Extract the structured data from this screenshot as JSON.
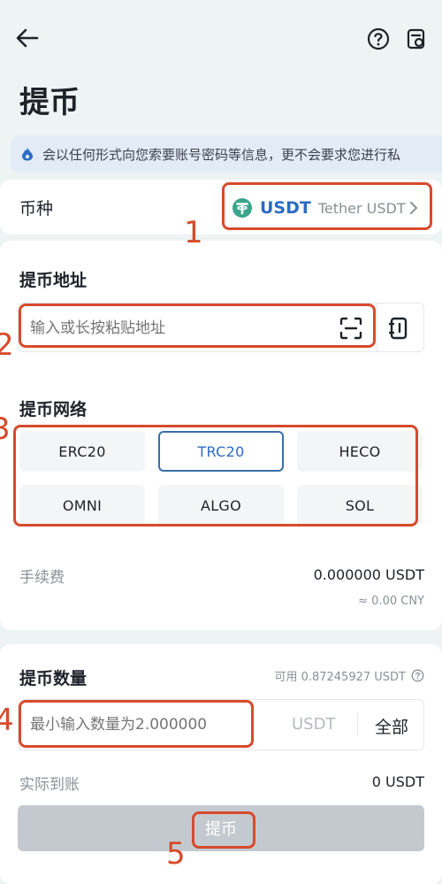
{
  "header": {
    "title": "提币"
  },
  "notice": {
    "text": "会以任何形式向您索要账号密码等信息，更不会要求您进行私"
  },
  "currency": {
    "label": "币种",
    "symbol": "USDT",
    "full_name": "Tether USDT"
  },
  "address": {
    "title": "提币地址",
    "placeholder": "输入或长按粘贴地址"
  },
  "network": {
    "title": "提币网络",
    "options": [
      "ERC20",
      "TRC20",
      "HECO",
      "OMNI",
      "ALGO",
      "SOL"
    ],
    "selected": "TRC20"
  },
  "fee": {
    "label": "手续费",
    "value": "0.000000 USDT",
    "cny": "≈ 0.00 CNY"
  },
  "amount": {
    "title": "提币数量",
    "available": "可用 0.87245927 USDT",
    "placeholder": "最小输入数量为2.000000",
    "unit": "USDT",
    "all_label": "全部"
  },
  "received": {
    "label": "实际到账",
    "value": "0 USDT"
  },
  "submit": {
    "label": "提币"
  },
  "annotations": [
    "1",
    "2",
    "3",
    "4",
    "5"
  ],
  "colors": {
    "background": "#eef3f3",
    "accent": "#2b6cc4",
    "annotation": "#d64b2c",
    "tether": "#3aa58c",
    "submit_button": "#c4c9cf"
  }
}
